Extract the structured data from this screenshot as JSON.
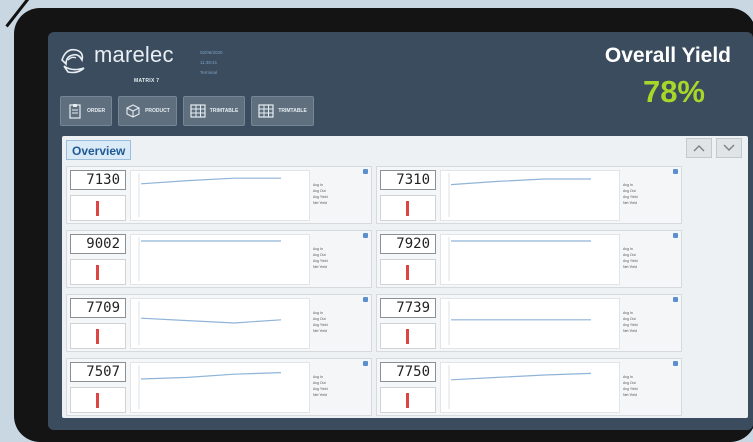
{
  "brand": {
    "name": "marelec",
    "model": "MATRIX 7"
  },
  "session": {
    "date": "02/06/2020",
    "time": "11:38:41",
    "station": "Terminal"
  },
  "yield": {
    "label": "Overall Yield",
    "value": "78%"
  },
  "toolbar": {
    "buttons": [
      {
        "label": "ORDER",
        "icon": "clipboard-icon"
      },
      {
        "label": "PRODUCT",
        "icon": "box-icon"
      },
      {
        "label": "TRIMTABLE",
        "icon": "table-icon"
      },
      {
        "label": "TRIMTABLE",
        "icon": "table-icon"
      }
    ]
  },
  "overview": {
    "tab_label": "Overview"
  },
  "stat_labels": [
    "Avg In",
    "Avg Out",
    "Avg Yield",
    "Net Yield"
  ],
  "cards": [
    {
      "counter": "7130",
      "trend": [
        0.78,
        0.86,
        0.92,
        0.92
      ]
    },
    {
      "counter": "7310",
      "trend": [
        0.76,
        0.84,
        0.9,
        0.9
      ]
    },
    {
      "counter": "9002",
      "trend": [
        0.95,
        0.95,
        0.95,
        0.95
      ]
    },
    {
      "counter": "7920",
      "trend": [
        0.95,
        0.95,
        0.95,
        0.95
      ]
    },
    {
      "counter": "7709",
      "trend": [
        0.62,
        0.56,
        0.5,
        0.58
      ]
    },
    {
      "counter": "7739",
      "trend": [
        0.58,
        0.58,
        0.58,
        0.58
      ]
    },
    {
      "counter": "7507",
      "trend": [
        0.7,
        0.74,
        0.82,
        0.86
      ]
    },
    {
      "counter": "7750",
      "trend": [
        0.68,
        0.74,
        0.8,
        0.84
      ]
    }
  ],
  "colors": {
    "accent_yield": "#a6d82a",
    "header_bg": "#3a4c5d",
    "trend_line": "#8fb4d8"
  }
}
